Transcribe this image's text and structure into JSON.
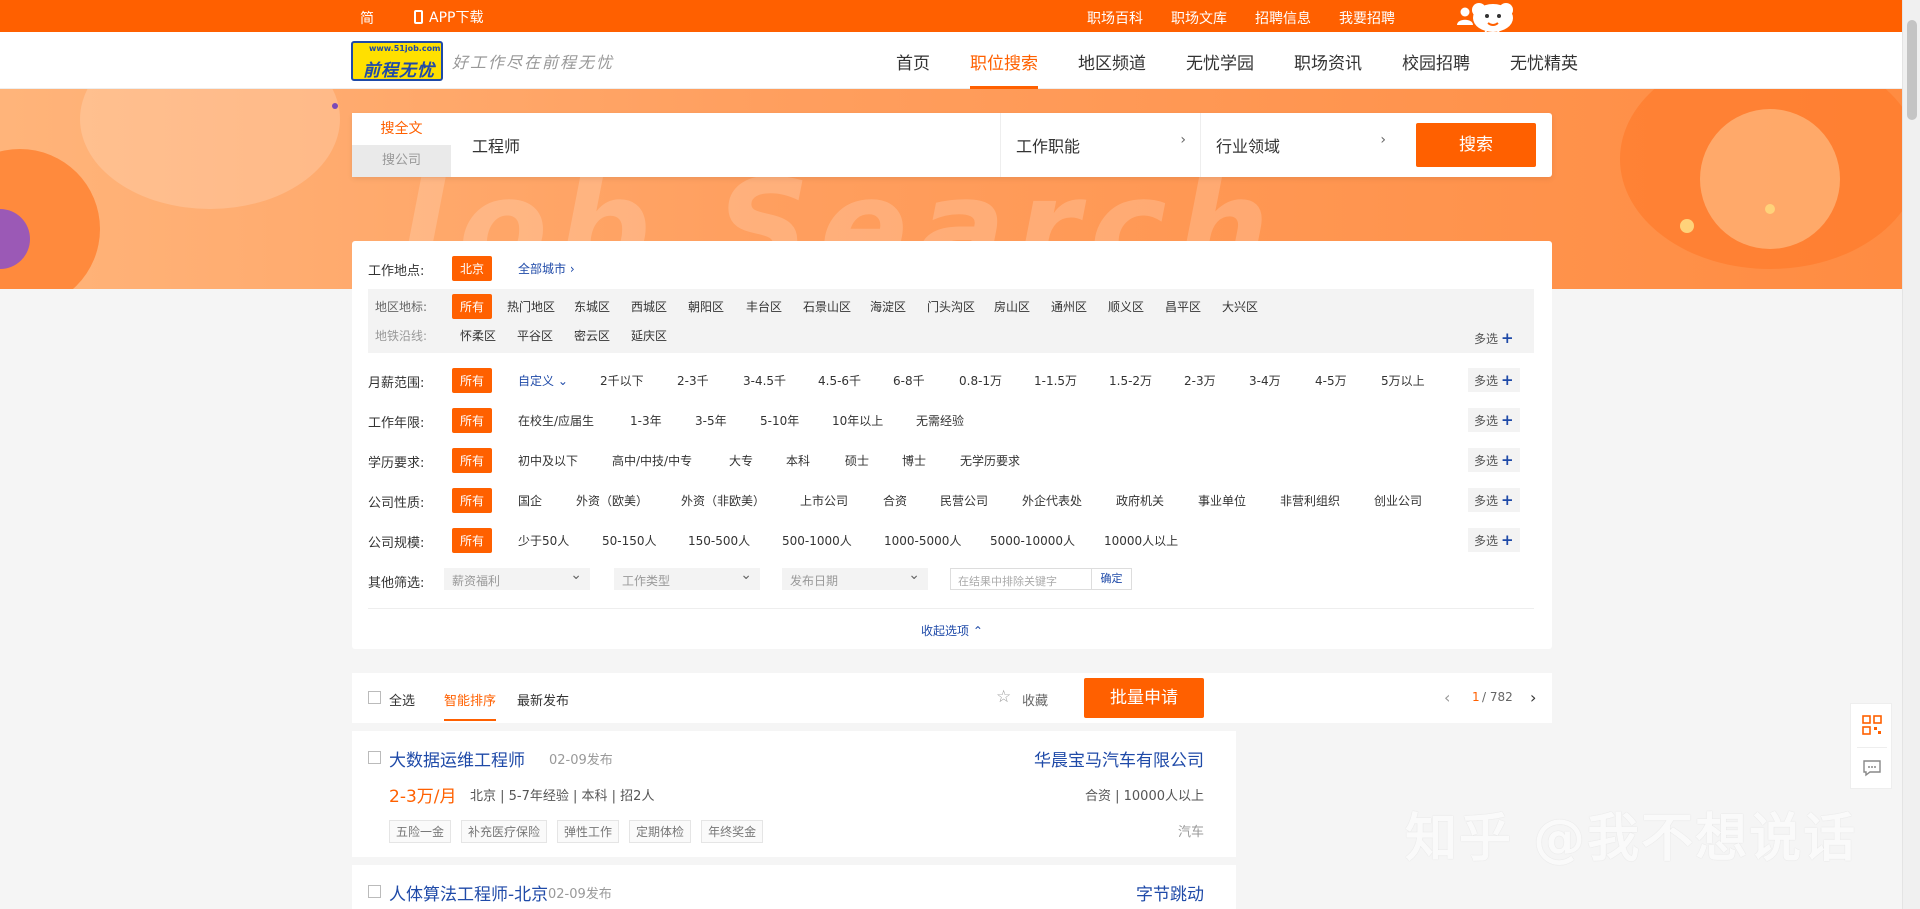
{
  "topbar": {
    "simplified": "简",
    "app_download": "APP下载",
    "links": [
      "职场百科",
      "职场文库",
      "招聘信息",
      "我要招聘"
    ]
  },
  "header": {
    "logo_url": "www.51job.com",
    "logo_name": "前程无忧",
    "slogan": "好工作尽在前程无忧",
    "nav": [
      "首页",
      "职位搜索",
      "地区频道",
      "无忧学园",
      "职场资讯",
      "校园招聘",
      "无忧精英"
    ],
    "active_nav": "职位搜索"
  },
  "banner": {
    "bg_text": "Job Search"
  },
  "search": {
    "tab_fulltext": "搜全文",
    "tab_company": "搜公司",
    "keyword": "工程师",
    "function_select": "工作职能",
    "industry_select": "行业领域",
    "button": "搜索",
    "arrow": "›"
  },
  "filters": {
    "location_label": "工作地点:",
    "location_current": "北京",
    "all_cities": "全部城市",
    "district_label": "地区地标:",
    "metro_label": "地铁沿线:",
    "district_all": "所有",
    "districts_row1": [
      "热门地区",
      "东城区",
      "西城区",
      "朝阳区",
      "丰台区",
      "石景山区",
      "海淀区",
      "门头沟区",
      "房山区",
      "通州区",
      "顺义区",
      "昌平区",
      "大兴区"
    ],
    "districts_row2": [
      "怀柔区",
      "平谷区",
      "密云区",
      "延庆区"
    ],
    "multi_select": "多选",
    "salary_label": "月薪范围:",
    "salary_all": "所有",
    "salary_custom": "自定义",
    "salary_options": [
      "2千以下",
      "2-3千",
      "3-4.5千",
      "4.5-6千",
      "6-8千",
      "0.8-1万",
      "1-1.5万",
      "1.5-2万",
      "2-3万",
      "3-4万",
      "4-5万",
      "5万以上"
    ],
    "exp_label": "工作年限:",
    "exp_all": "所有",
    "exp_options": [
      "在校生/应届生",
      "1-3年",
      "3-5年",
      "5-10年",
      "10年以上",
      "无需经验"
    ],
    "edu_label": "学历要求:",
    "edu_all": "所有",
    "edu_options": [
      "初中及以下",
      "高中/中技/中专",
      "大专",
      "本科",
      "硕士",
      "博士",
      "无学历要求"
    ],
    "ctype_label": "公司性质:",
    "ctype_all": "所有",
    "ctype_options": [
      "国企",
      "外资（欧美）",
      "外资（非欧美）",
      "上市公司",
      "合资",
      "民营公司",
      "外企代表处",
      "政府机关",
      "事业单位",
      "非营利组织",
      "创业公司"
    ],
    "csize_label": "公司规模:",
    "csize_all": "所有",
    "csize_options": [
      "少于50人",
      "50-150人",
      "150-500人",
      "500-1000人",
      "1000-5000人",
      "5000-10000人",
      "10000人以上"
    ],
    "other_label": "其他筛选:",
    "dropdown_welfare": "薪资福利",
    "dropdown_jobtype": "工作类型",
    "dropdown_date": "发布日期",
    "exclude_placeholder": "在结果中排除关键字",
    "exclude_confirm": "确定",
    "collapse": "收起选项"
  },
  "toolbar": {
    "select_all": "全选",
    "sort_smart": "智能排序",
    "sort_latest": "最新发布",
    "favorite": "收藏",
    "batch_apply": "批量申请",
    "page_current": "1",
    "page_total": "/ 782",
    "prev": "‹",
    "next": "›"
  },
  "jobs": [
    {
      "title": "大数据运维工程师",
      "date": "02-09发布",
      "company": "华晨宝马汽车有限公司",
      "salary": "2-3万/月",
      "meta": "北京 | 5-7年经验 | 本科 | 招2人",
      "company_info": "合资 | 10000人以上",
      "welfare": [
        "五险一金",
        "补充医疗保险",
        "弹性工作",
        "定期体检",
        "年终奖金"
      ],
      "industry": "汽车"
    },
    {
      "title": "人体算法工程师-北京",
      "date": "02-09发布",
      "company": "字节跳动"
    }
  ],
  "watermark": "知乎 @我不想说话",
  "colors": {
    "brand": "#ff6000",
    "link": "#1f4aa8"
  }
}
